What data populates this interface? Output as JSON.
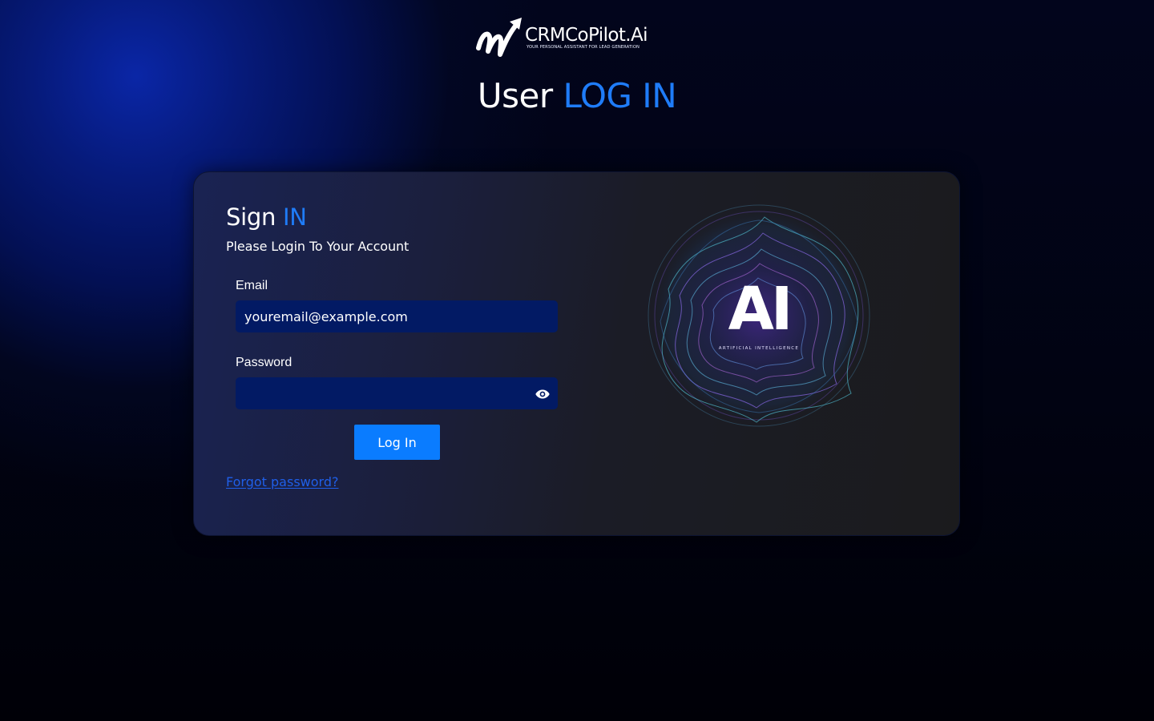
{
  "brand": {
    "name": "CRMCoPilot.Ai",
    "tagline": "YOUR PERSONAL ASSISTANT FOR LEAD GENERATION",
    "logo_icon": "rising-arrow-w-icon"
  },
  "page_title": {
    "prefix": "User",
    "accent": "LOG IN"
  },
  "signin": {
    "heading_prefix": "Sign",
    "heading_accent": "IN",
    "subtitle": "Please Login To Your Account"
  },
  "form": {
    "email": {
      "label": "Email",
      "value": "",
      "placeholder": "youremail@example.com"
    },
    "password": {
      "label": "Password",
      "value": "",
      "toggle_icon": "eye-icon"
    },
    "login_label": "Log In",
    "forgot_label": "Forgot password?"
  },
  "illustration": {
    "title": "AI",
    "subtitle": "ARTIFICIAL INTELLIGENCE"
  },
  "colors": {
    "accent": "#1f7cf8",
    "button": "#0a7cff",
    "input_bg": "#021a64",
    "link": "#1f5fe8",
    "card_bg": "#1b1b1d"
  }
}
